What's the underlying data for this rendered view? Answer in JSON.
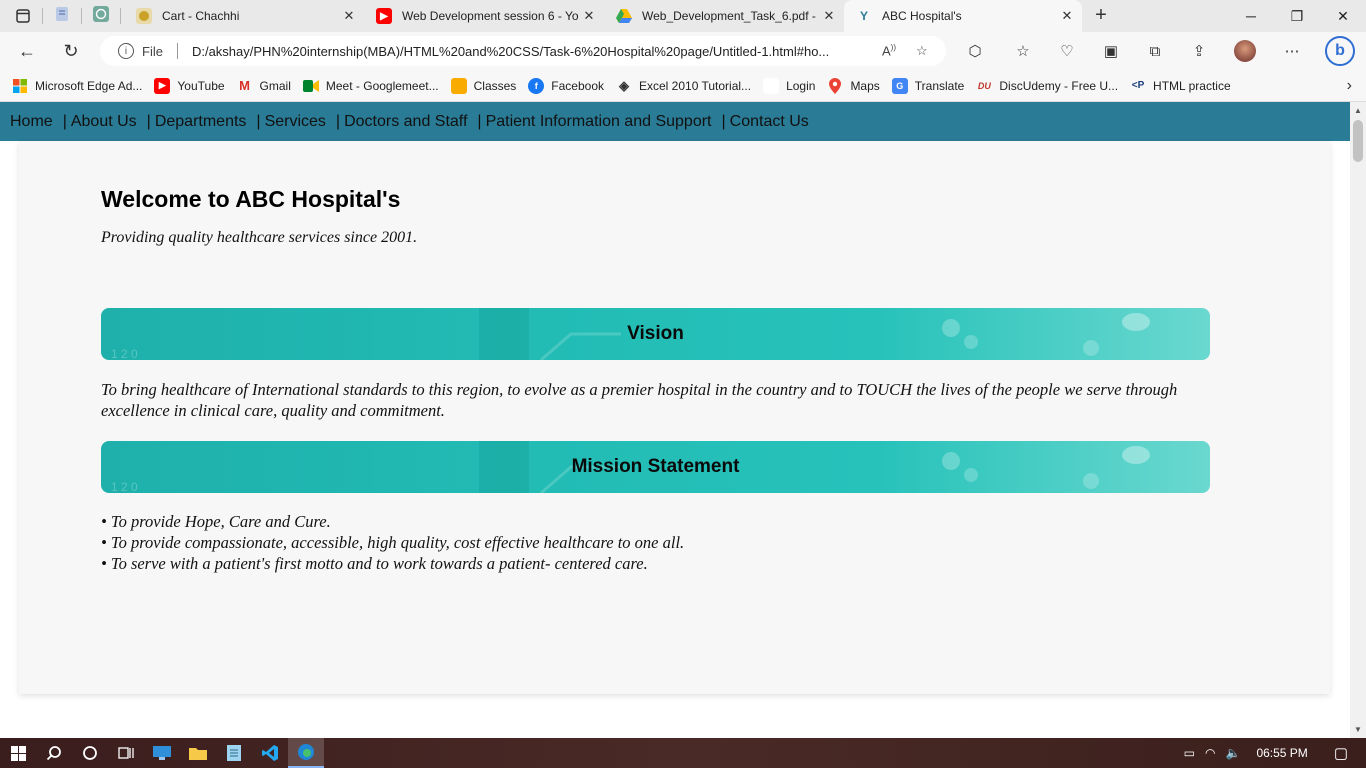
{
  "browser": {
    "tabs": [
      {
        "title": "Cart - Chachhi",
        "favicon_color": "#c9a227",
        "active": false
      },
      {
        "title": "Web Development session 6 - Yo",
        "favicon_color": "#ff0000",
        "active": false
      },
      {
        "title": "Web_Development_Task_6.pdf - (",
        "favicon_color": "#34a853",
        "active": false
      },
      {
        "title": "ABC Hospital's",
        "favicon_color": "#2a7b96",
        "active": true
      }
    ],
    "address": {
      "scheme_label": "File",
      "url": "D:/akshay/PHN%20internship(MBA)/HTML%20and%20CSS/Task-6%20Hospital%20page/Untitled-1.html#ho..."
    },
    "bookmarks": [
      {
        "label": "Microsoft Edge Ad...",
        "icon": "microsoft-icon"
      },
      {
        "label": "YouTube",
        "icon": "youtube-icon"
      },
      {
        "label": "Gmail",
        "icon": "gmail-icon"
      },
      {
        "label": "Meet - Googlemeet...",
        "icon": "meet-icon"
      },
      {
        "label": "Classes",
        "icon": "classroom-icon"
      },
      {
        "label": "Facebook",
        "icon": "facebook-icon"
      },
      {
        "label": "Excel 2010 Tutorial...",
        "icon": "excel-icon"
      },
      {
        "label": "Login",
        "icon": "page-icon"
      },
      {
        "label": "Maps",
        "icon": "maps-icon"
      },
      {
        "label": "Translate",
        "icon": "translate-icon"
      },
      {
        "label": "DiscUdemy - Free U...",
        "icon": "discudemy-icon"
      },
      {
        "label": "HTML practice",
        "icon": "html-practice-icon"
      }
    ]
  },
  "site": {
    "nav": [
      "Home",
      "About Us",
      "Departments",
      "Services",
      "Doctors and Staff",
      "Patient Information and Support",
      "Contact Us"
    ],
    "nav_separator": "|",
    "heading": "Welcome to ABC Hospital's",
    "tagline": "Providing quality healthcare services since 2001.",
    "vision": {
      "title": "Vision",
      "text": "To bring healthcare of International standards to this region, to evolve as a premier hospital in the country and to TOUCH the lives of the people we serve through excellence in clinical care, quality and commitment."
    },
    "mission": {
      "title": "Mission Statement",
      "items": [
        "• To provide Hope, Care and Cure.",
        "• To provide compassionate, accessible, high quality, cost effective healthcare to one all.",
        "• To serve with a patient's first motto and to work towards a patient- centered care."
      ]
    }
  },
  "taskbar": {
    "time": "06:55 PM"
  },
  "colors": {
    "nav_bg": "#2a7b96",
    "banner": "#22bcb5",
    "card_bg": "#f7f7f7"
  }
}
